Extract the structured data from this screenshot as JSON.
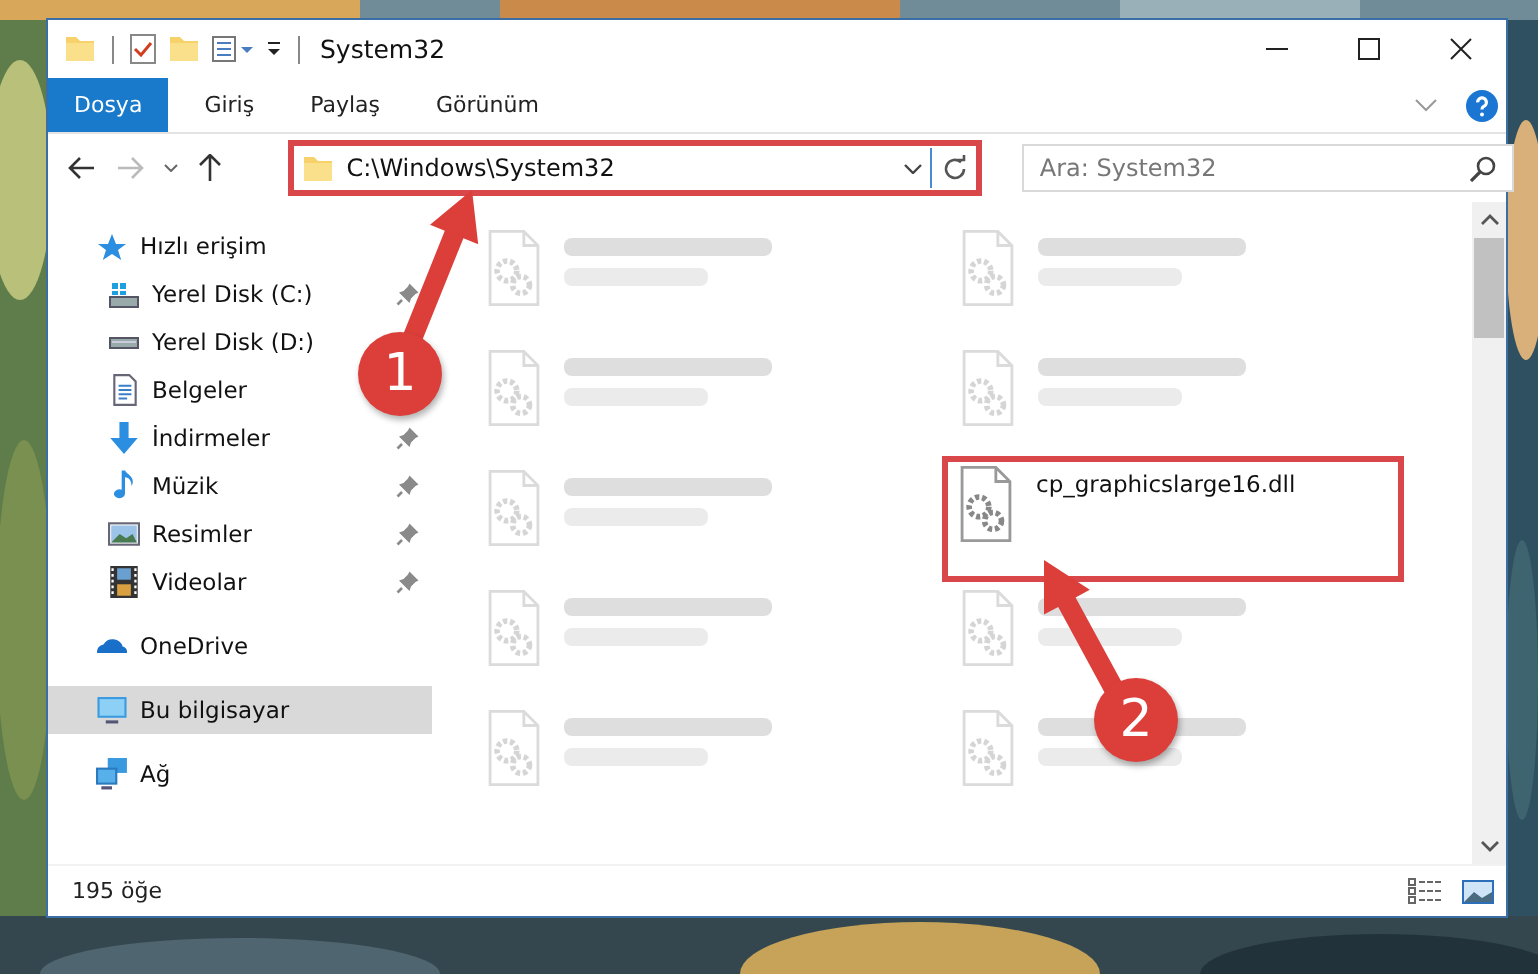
{
  "window": {
    "title": "System32"
  },
  "ribbon_tabs": [
    {
      "label": "Dosya",
      "selected": true
    },
    {
      "label": "Giriş",
      "selected": false
    },
    {
      "label": "Paylaş",
      "selected": false
    },
    {
      "label": "Görünüm",
      "selected": false
    }
  ],
  "address_bar": {
    "path": "C:\\Windows\\System32",
    "highlighted": true
  },
  "search": {
    "placeholder": "Ara: System32"
  },
  "sidebar": {
    "items": [
      {
        "label": "Hızlı erişim",
        "kind": "quick-access",
        "selected": false,
        "children": [
          {
            "label": "Yerel Disk (C:)",
            "kind": "system-drive",
            "pinned": true,
            "selected": false
          },
          {
            "label": "Yerel Disk (D:)",
            "kind": "drive",
            "pinned": false,
            "selected": false
          },
          {
            "label": "Belgeler",
            "kind": "documents",
            "pinned": false,
            "selected": false
          },
          {
            "label": "İndirmeler",
            "kind": "downloads",
            "pinned": true,
            "selected": false
          },
          {
            "label": "Müzik",
            "kind": "music",
            "pinned": true,
            "selected": false
          },
          {
            "label": "Resimler",
            "kind": "pictures",
            "pinned": true,
            "selected": false
          },
          {
            "label": "Videolar",
            "kind": "videos",
            "pinned": true,
            "selected": false
          }
        ]
      },
      {
        "label": "OneDrive",
        "kind": "cloud",
        "selected": false
      },
      {
        "label": "Bu bilgisayar",
        "kind": "computer",
        "selected": true
      },
      {
        "label": "Ağ",
        "kind": "network",
        "selected": false
      }
    ]
  },
  "files": [
    {
      "blurred": true,
      "highlighted": false
    },
    {
      "blurred": true,
      "highlighted": false
    },
    {
      "blurred": true,
      "highlighted": false
    },
    {
      "blurred": true,
      "highlighted": false
    },
    {
      "blurred": true,
      "highlighted": false
    },
    {
      "name": "cp_graphicslarge16.dll",
      "blurred": false,
      "highlighted": true
    },
    {
      "blurred": true,
      "highlighted": false
    },
    {
      "blurred": true,
      "highlighted": false
    },
    {
      "blurred": true,
      "highlighted": false
    },
    {
      "blurred": true,
      "highlighted": false
    }
  ],
  "status_bar": {
    "item_count": "195 öğe"
  },
  "annotations": [
    {
      "label": "1"
    },
    {
      "label": "2"
    }
  ]
}
